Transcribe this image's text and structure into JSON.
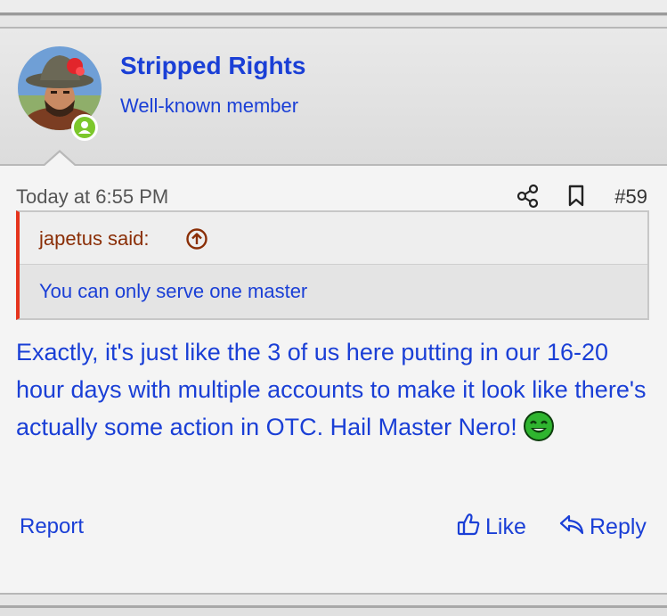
{
  "post": {
    "username": "Stripped Rights",
    "user_title": "Well-known member",
    "timestamp": "Today at 6:55 PM",
    "post_number": "#59",
    "quote": {
      "author": "japetus said:",
      "text": "You can only serve one master"
    },
    "body": "Exactly, it's just like the 3 of us here putting in our 16-20 hour days with multiple accounts to make it look like there's actually some action in OTC. Hail Master Nero!",
    "actions": {
      "report": "Report",
      "like": "Like",
      "reply": "Reply"
    }
  },
  "icons": {
    "share": "share-icon",
    "bookmark": "bookmark-icon",
    "quote_jump": "arrow-up-circle-icon",
    "like": "thumbs-up-icon",
    "reply": "reply-arrow-icon",
    "smiley": "grin-smiley-icon"
  },
  "colors": {
    "link": "#1a3fd6",
    "quote_author": "#8a2e06",
    "quote_border": "#e5341d",
    "online": "#7cc72b"
  }
}
